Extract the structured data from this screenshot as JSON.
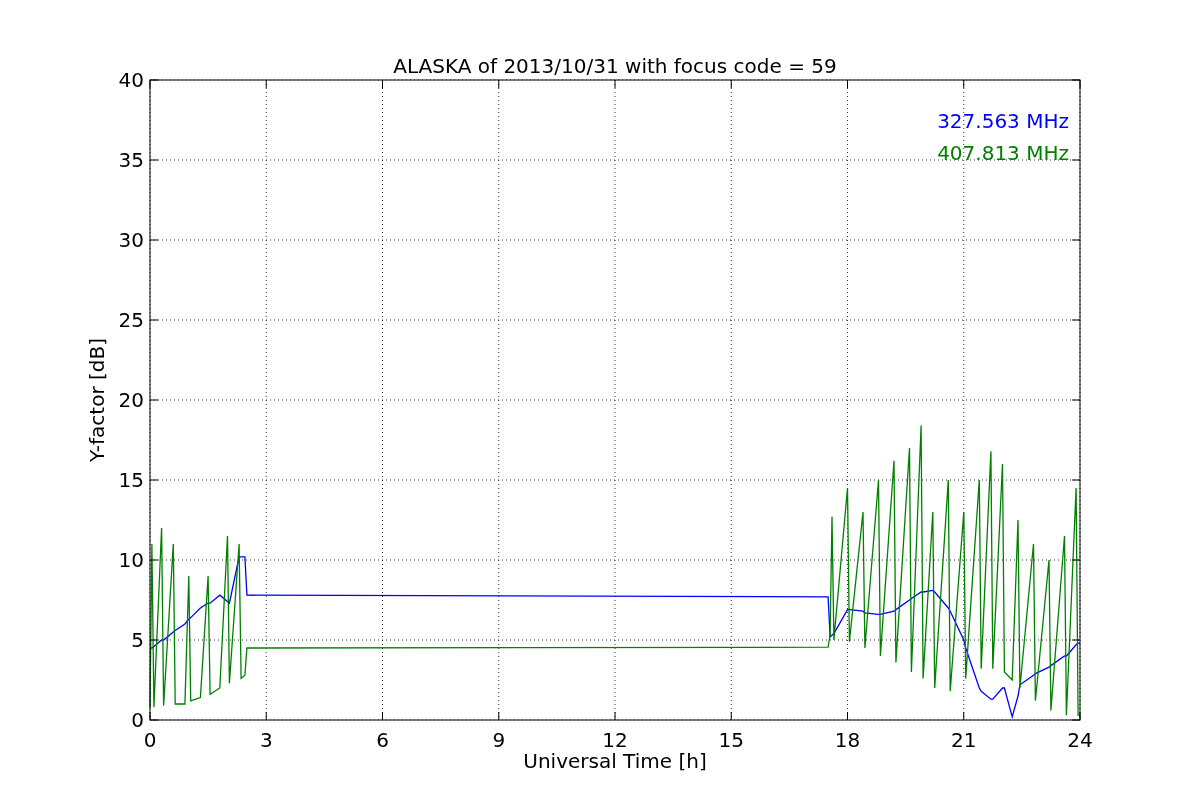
{
  "chart_data": {
    "type": "line",
    "title": "ALASKA of 2013/10/31 with focus code = 59",
    "xlabel": "Universal Time [h]",
    "ylabel": "Y-factor [dB]",
    "x": [
      0,
      0.05,
      0.1,
      0.3,
      0.35,
      0.6,
      0.65,
      0.9,
      1.0,
      1.05,
      1.3,
      1.5,
      1.55,
      1.8,
      2.0,
      2.05,
      2.3,
      2.35,
      2.45,
      2.5,
      17.5,
      17.55,
      17.6,
      17.65,
      18.0,
      18.05,
      18.4,
      18.45,
      18.8,
      18.85,
      19.2,
      19.25,
      19.6,
      19.65,
      19.9,
      19.95,
      20.2,
      20.25,
      20.6,
      20.65,
      21.0,
      21.05,
      21.4,
      21.45,
      21.7,
      21.75,
      22.0,
      22.05,
      22.25,
      22.4,
      22.45,
      22.8,
      22.85,
      23.2,
      23.25,
      23.6,
      23.65,
      23.9,
      23.95,
      24
    ],
    "series": [
      {
        "name": "327.563 MHz",
        "color": "#0000ff",
        "values": [
          4.5,
          4.5,
          4.6,
          5.0,
          5.0,
          5.5,
          5.6,
          6.0,
          6.3,
          6.4,
          7.0,
          7.3,
          7.3,
          7.8,
          7.4,
          7.3,
          10.2,
          10.2,
          10.2,
          7.8,
          7.7,
          5.2,
          5.3,
          5.4,
          6.9,
          6.9,
          6.8,
          6.7,
          6.6,
          6.6,
          6.8,
          6.9,
          7.5,
          7.6,
          8.0,
          8.0,
          8.1,
          8.0,
          7.0,
          6.8,
          5.0,
          4.5,
          2.0,
          1.8,
          1.3,
          1.3,
          2.0,
          2.0,
          0.2,
          1.5,
          2.2,
          2.8,
          2.9,
          3.3,
          3.4,
          4.0,
          4.0,
          4.7,
          4.8,
          4.8
        ]
      },
      {
        "name": "407.813 MHz",
        "color": "#008000",
        "values": [
          0.8,
          11,
          0.8,
          12,
          0.9,
          11,
          1.0,
          1.0,
          9,
          1.2,
          1.4,
          9,
          1.6,
          2.0,
          11.5,
          2.3,
          11,
          2.6,
          2.8,
          4.5,
          4.55,
          5.3,
          12.7,
          5.0,
          14.5,
          4.9,
          13,
          4.5,
          15,
          4.0,
          16.2,
          3.6,
          17,
          3.0,
          18.4,
          2.6,
          13,
          2.0,
          15,
          1.8,
          13,
          2.6,
          15,
          3.2,
          16.8,
          3.2,
          16,
          3.0,
          2.5,
          12.5,
          2.0,
          11,
          1.2,
          10,
          0.6,
          11.5,
          0.3,
          14.5,
          0.3,
          0.3
        ]
      }
    ],
    "grid": true,
    "xlim": [
      0,
      24
    ],
    "ylim": [
      0,
      40
    ],
    "xticks": [
      0,
      3,
      6,
      9,
      12,
      15,
      18,
      21,
      24
    ],
    "yticks": [
      0,
      5,
      10,
      15,
      20,
      25,
      30,
      35,
      40
    ]
  }
}
